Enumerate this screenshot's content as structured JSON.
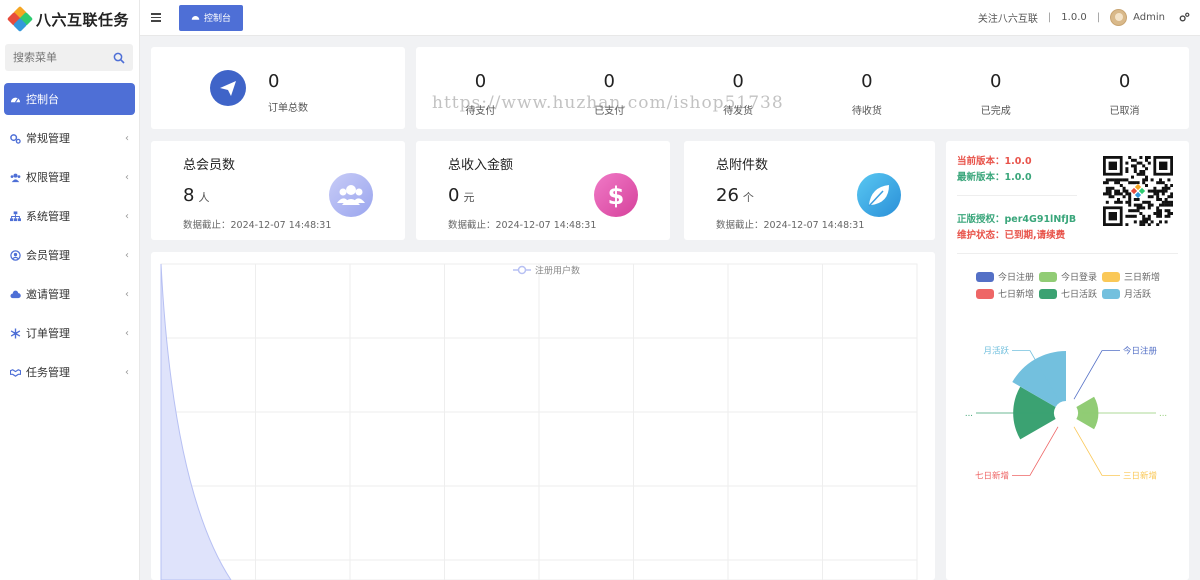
{
  "brand": {
    "name": "八六互联任务"
  },
  "search": {
    "placeholder": "搜索菜单"
  },
  "menu": [
    {
      "label": "控制台",
      "icon": "dashboard-icon"
    },
    {
      "label": "常规管理",
      "icon": "cogs-icon"
    },
    {
      "label": "权限管理",
      "icon": "users-icon"
    },
    {
      "label": "系统管理",
      "icon": "sitemap-icon"
    },
    {
      "label": "会员管理",
      "icon": "user-circle-icon"
    },
    {
      "label": "邀请管理",
      "icon": "cloud-icon"
    },
    {
      "label": "订单管理",
      "icon": "snowflake-icon"
    },
    {
      "label": "任务管理",
      "icon": "handshake-icon"
    }
  ],
  "header": {
    "tab_label": "控制台",
    "follow": "关注八六互联",
    "version": "1.0.0",
    "user": "Admin"
  },
  "orders": {
    "value": "0",
    "label": "订单总数"
  },
  "order_status": [
    {
      "value": "0",
      "label": "待支付"
    },
    {
      "value": "0",
      "label": "已支付"
    },
    {
      "value": "0",
      "label": "待发货"
    },
    {
      "value": "0",
      "label": "待收货"
    },
    {
      "value": "0",
      "label": "已完成"
    },
    {
      "value": "0",
      "label": "已取消"
    }
  ],
  "watermark": "https://www.huzhan.com/ishop51738",
  "stats": {
    "members": {
      "title": "总会员数",
      "value": "8",
      "unit": "人",
      "time": "数据截止：2024-12-07 14:48:31"
    },
    "income": {
      "title": "总收入金额",
      "value": "0",
      "unit": "元",
      "time": "数据截止：2024-12-07 14:48:31"
    },
    "files": {
      "title": "总附件数",
      "value": "26",
      "unit": "个",
      "time": "数据截止：2024-12-07 14:48:31"
    }
  },
  "version_info": {
    "current": "当前版本：1.0.0",
    "latest": "最新版本：1.0.0",
    "license": "正版授权：per4G91lNfJB",
    "maintenance": "维护状态：已到期,请续费"
  },
  "colors": {
    "accent": "#4e6fd6",
    "red": "#e8534a",
    "green": "#3aa67b"
  },
  "chart_data": [
    {
      "type": "area",
      "series": [
        {
          "name": "注册用户数",
          "values": []
        }
      ],
      "grid": true
    },
    {
      "type": "pie",
      "rose": true,
      "categories": [
        "今日注册",
        "今日登录",
        "三日新增",
        "七日新增",
        "七日活跃",
        "月活跃"
      ],
      "colors": [
        "#5470c6",
        "#91cc75",
        "#fac858",
        "#ee6666",
        "#3ba272",
        "#73c0de"
      ],
      "values": [
        0,
        2,
        0,
        0,
        8,
        12
      ],
      "outer_labels": [
        "今日注册",
        "...",
        "三日新增",
        "七日新增",
        "...",
        "月活跃"
      ],
      "legend": "top"
    }
  ]
}
